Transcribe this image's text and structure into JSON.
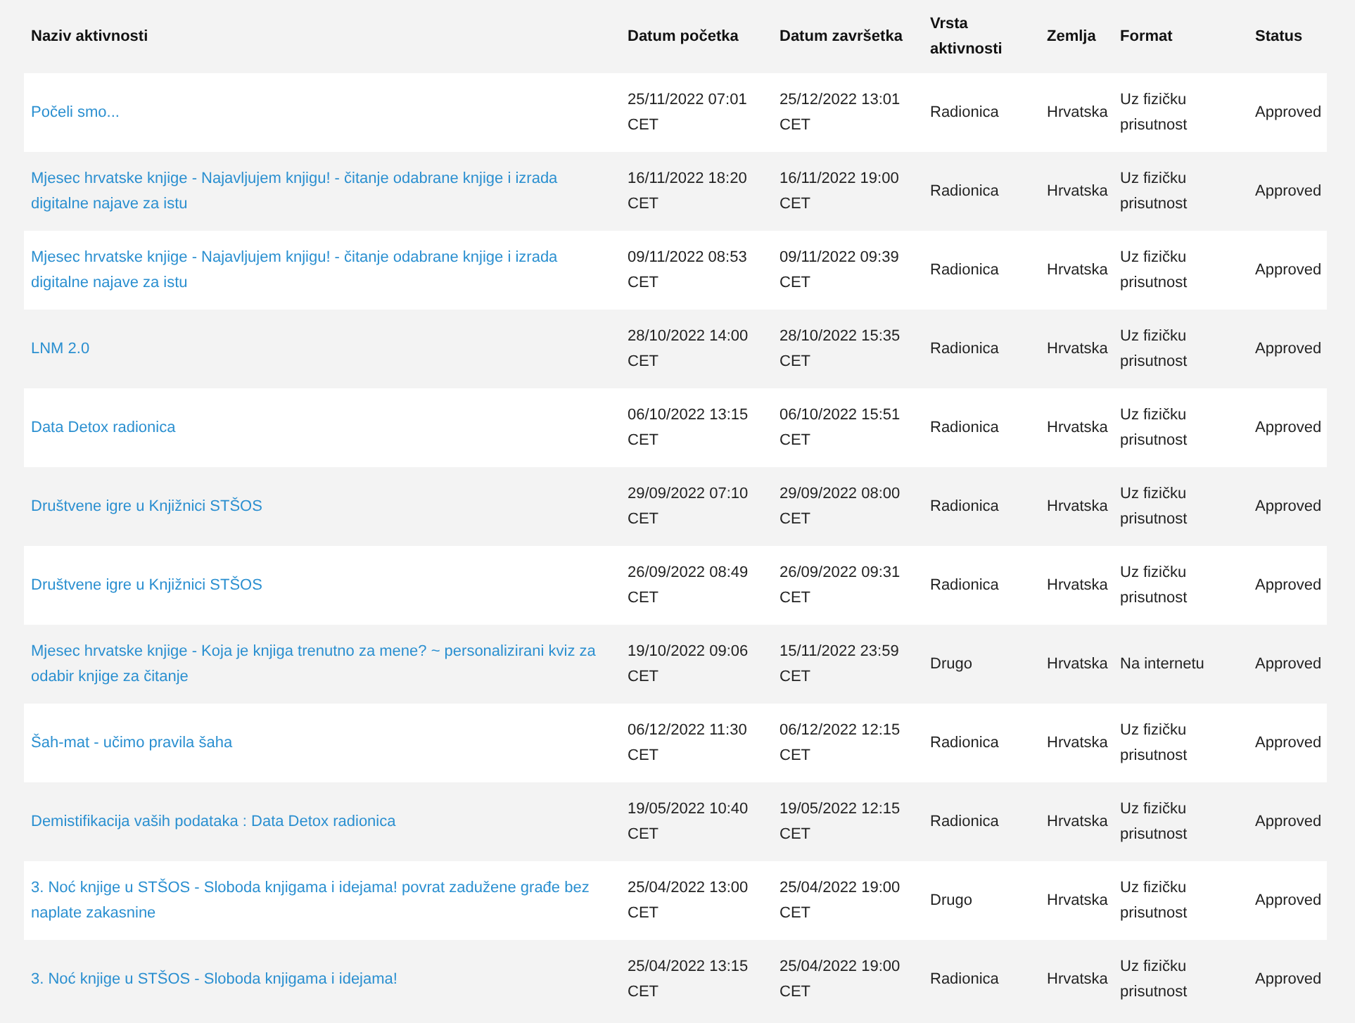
{
  "table": {
    "columns": [
      "Naziv aktivnosti",
      "Datum početka",
      "Datum završetka",
      "Vrsta aktivnosti",
      "Zemlja",
      "Format",
      "Status"
    ],
    "rows": [
      {
        "name": "Počeli smo...",
        "start": "25/11/2022 07:01 CET",
        "end": "25/12/2022 13:01 CET",
        "type": "Radionica",
        "country": "Hrvatska",
        "format": "Uz fizičku prisutnost",
        "status": "Approved"
      },
      {
        "name": "Mjesec hrvatske knjige - Najavljujem knjigu! - čitanje odabrane knjige i izrada digitalne najave za istu",
        "start": "16/11/2022 18:20 CET",
        "end": "16/11/2022 19:00 CET",
        "type": "Radionica",
        "country": "Hrvatska",
        "format": "Uz fizičku prisutnost",
        "status": "Approved"
      },
      {
        "name": "Mjesec hrvatske knjige - Najavljujem knjigu! - čitanje odabrane knjige i izrada digitalne najave za istu",
        "start": "09/11/2022 08:53 CET",
        "end": "09/11/2022 09:39 CET",
        "type": "Radionica",
        "country": "Hrvatska",
        "format": "Uz fizičku prisutnost",
        "status": "Approved"
      },
      {
        "name": "LNM 2.0",
        "start": "28/10/2022 14:00 CET",
        "end": "28/10/2022 15:35 CET",
        "type": "Radionica",
        "country": "Hrvatska",
        "format": "Uz fizičku prisutnost",
        "status": "Approved"
      },
      {
        "name": "Data Detox radionica",
        "start": "06/10/2022 13:15 CET",
        "end": "06/10/2022 15:51 CET",
        "type": "Radionica",
        "country": "Hrvatska",
        "format": "Uz fizičku prisutnost",
        "status": "Approved"
      },
      {
        "name": "Društvene igre u Knjižnici STŠOS",
        "start": "29/09/2022 07:10 CET",
        "end": "29/09/2022 08:00 CET",
        "type": "Radionica",
        "country": "Hrvatska",
        "format": "Uz fizičku prisutnost",
        "status": "Approved"
      },
      {
        "name": "Društvene igre u Knjižnici STŠOS",
        "start": "26/09/2022 08:49 CET",
        "end": "26/09/2022 09:31 CET",
        "type": "Radionica",
        "country": "Hrvatska",
        "format": "Uz fizičku prisutnost",
        "status": "Approved"
      },
      {
        "name": "Mjesec hrvatske knjige - Koja je knjiga trenutno za mene? ~ personalizirani kviz za odabir knjige za čitanje",
        "start": "19/10/2022 09:06 CET",
        "end": "15/11/2022 23:59 CET",
        "type": "Drugo",
        "country": "Hrvatska",
        "format": "Na internetu",
        "status": "Approved"
      },
      {
        "name": "Šah-mat - učimo pravila šaha",
        "start": "06/12/2022 11:30 CET",
        "end": "06/12/2022 12:15 CET",
        "type": "Radionica",
        "country": "Hrvatska",
        "format": "Uz fizičku prisutnost",
        "status": "Approved"
      },
      {
        "name": "Demistifikacija vaših podataka : Data Detox radionica",
        "start": "19/05/2022 10:40 CET",
        "end": "19/05/2022 12:15 CET",
        "type": "Radionica",
        "country": "Hrvatska",
        "format": "Uz fizičku prisutnost",
        "status": "Approved"
      },
      {
        "name": "3. Noć knjige u STŠOS - Sloboda knjigama i idejama! povrat zadužene građe bez naplate zakasnine",
        "start": "25/04/2022 13:00 CET",
        "end": "25/04/2022 19:00 CET",
        "type": "Drugo",
        "country": "Hrvatska",
        "format": "Uz fizičku prisutnost",
        "status": "Approved"
      },
      {
        "name": "3. Noć knjige u STŠOS - Sloboda knjigama i idejama!",
        "start": "25/04/2022 13:15 CET",
        "end": "25/04/2022 19:00 CET",
        "type": "Radionica",
        "country": "Hrvatska",
        "format": "Uz fizičku prisutnost",
        "status": "Approved"
      }
    ]
  }
}
